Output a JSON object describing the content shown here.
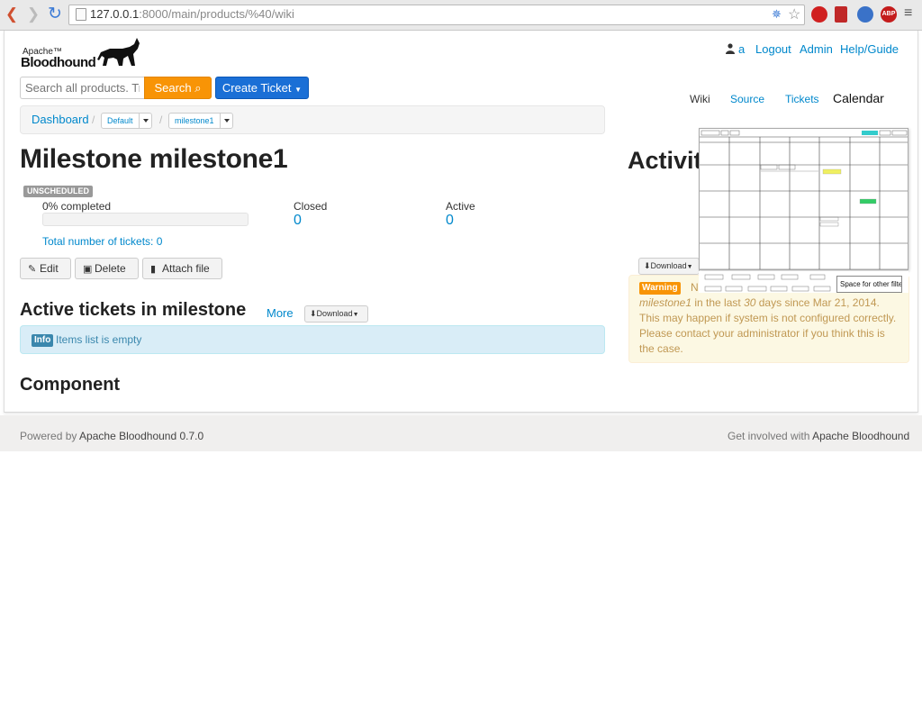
{
  "browser": {
    "url_host": "127.0.0.1",
    "url_rest": ":8000/main/products/%40/wiki"
  },
  "header": {
    "logo_small": "Apache™",
    "logo_big": "Bloodhound",
    "user_name": "a",
    "logout": "Logout",
    "admin": "Admin",
    "help": "Help/Guide"
  },
  "search": {
    "placeholder": "Search all products. Try",
    "button": "Search",
    "create_ticket": "Create Ticket"
  },
  "breadcrumb": {
    "dashboard": "Dashboard",
    "product": "Default",
    "milestone": "milestone1"
  },
  "milestone": {
    "title": "Milestone milestone1",
    "badge": "UNSCHEDULED",
    "completed_label": "0% completed",
    "progress": 0,
    "closed_label": "Closed",
    "closed_value": "0",
    "active_label": "Active",
    "active_value": "0",
    "total_link": "Total number of tickets: 0"
  },
  "actions": {
    "edit": "Edit",
    "delete": "Delete",
    "attach": "Attach file"
  },
  "active_tickets": {
    "title": "Active tickets in milestone",
    "more": "More",
    "download": "Download",
    "info_badge": "Info",
    "info_text": "Items list is empty"
  },
  "component_title": "Component",
  "activity": {
    "title": "Activity",
    "download": "Download",
    "warning_badge": "Warning",
    "warning_first": "N",
    "warning_ms": "milestone1",
    "warning_mid1": " in the last ",
    "warning_days": "30",
    "warning_mid2": " days since Mar 21, 2014. This may happen if system is not configured correctly. Please contact your administrator if you think this is the case."
  },
  "tabs": [
    "Wiki",
    "Source",
    "Tickets"
  ],
  "tab_calendar": "Calendar",
  "calendar": {
    "filter_text": "Space for other filter",
    "colors": {
      "header": "#33cccc",
      "event_yellow": "#f0f060",
      "event_green": "#33cc66"
    }
  },
  "footer": {
    "powered_prefix": "Powered by ",
    "powered_name": "Apache Bloodhound 0.7.0",
    "involved_prefix": "Get involved with ",
    "involved_name": "Apache Bloodhound"
  },
  "colors": {
    "link": "#0088cc",
    "search_orange": "#f89406",
    "create_blue": "#1a6fd6"
  }
}
